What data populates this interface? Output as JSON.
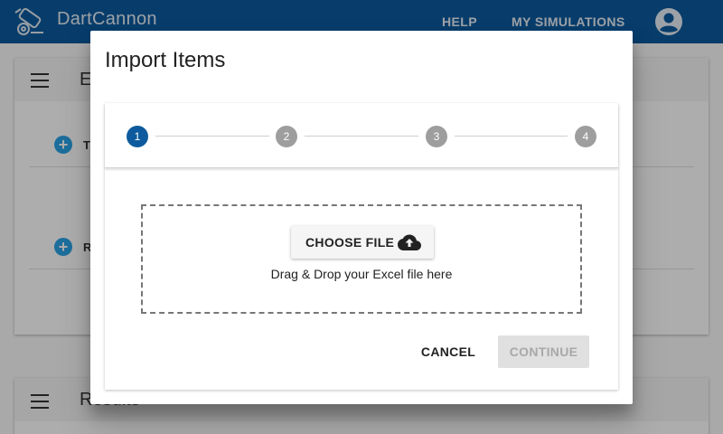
{
  "app": {
    "title": "DartCannon",
    "brand_color": "#0d5b9e"
  },
  "nav": {
    "help": "HELP",
    "my_simulations": "MY SIMULATIONS"
  },
  "background": {
    "card1_title": "E",
    "row1_label": "T",
    "row2_label": "R",
    "card2_title": "Results"
  },
  "dialog": {
    "title": "Import Items",
    "steps": [
      "1",
      "2",
      "3",
      "4"
    ],
    "active_step": 1,
    "choose_file_label": "CHOOSE FILE",
    "drop_text": "Drag & Drop your Excel file here",
    "cancel_label": "CANCEL",
    "continue_label": "CONTINUE"
  },
  "icons": {
    "logo": "cannon-logo-icon",
    "account": "account-circle-icon",
    "menu": "menu-icon",
    "add": "add-circle-icon",
    "upload": "cloud-upload-icon"
  }
}
